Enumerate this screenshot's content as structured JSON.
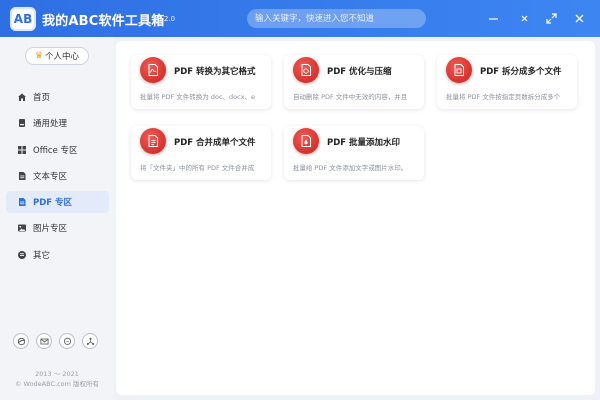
{
  "app": {
    "logo_text": "AB",
    "title": "我的ABC软件工具箱",
    "version": "v6.2.0",
    "search_placeholder": "输入关键字，快速进入您不知道"
  },
  "window_controls": [
    "minimize-icon",
    "pin-icon",
    "maximize-icon",
    "close-icon"
  ],
  "sidebar": {
    "user_center": "个人中心",
    "items": [
      {
        "label": "首页",
        "icon": "home-icon",
        "active": false
      },
      {
        "label": "通用处理",
        "icon": "general-icon",
        "active": false
      },
      {
        "label": "Office 专区",
        "icon": "office-icon",
        "active": false
      },
      {
        "label": "文本专区",
        "icon": "text-icon",
        "active": false
      },
      {
        "label": "PDF 专区",
        "icon": "pdf-icon",
        "active": true
      },
      {
        "label": "图片专区",
        "icon": "image-icon",
        "active": false
      },
      {
        "label": "其它",
        "icon": "other-icon",
        "active": false
      }
    ],
    "footer_icons": [
      "browser-icon",
      "mail-icon",
      "chat-icon",
      "share-icon"
    ],
    "copyright_years": "2013 ～ 2021",
    "copyright": "© WodeABC.com 版权所有"
  },
  "cards": [
    {
      "title": "PDF 转换为其它格式",
      "desc": "批量将 PDF 文件转换为 doc、docx、e",
      "icon": "pdf-convert-icon"
    },
    {
      "title": "PDF 优化与压缩",
      "desc": "自动删除 PDF 文件中无效的内容，并且",
      "icon": "pdf-compress-icon"
    },
    {
      "title": "PDF 拆分成多个文件",
      "desc": "批量将 PDF 文件按指定页数拆分成多个",
      "icon": "pdf-split-icon"
    },
    {
      "title": "PDF 合并成单个文件",
      "desc": "将「文件夹」中的所有 PDF 文件合并成",
      "icon": "pdf-merge-icon"
    },
    {
      "title": "PDF 批量添加水印",
      "desc": "批量给 PDF 文件添加文字或图片水印。",
      "icon": "pdf-watermark-icon"
    }
  ],
  "colors": {
    "accent": "#2f6fe4",
    "card_icon": "#d32f2f"
  }
}
